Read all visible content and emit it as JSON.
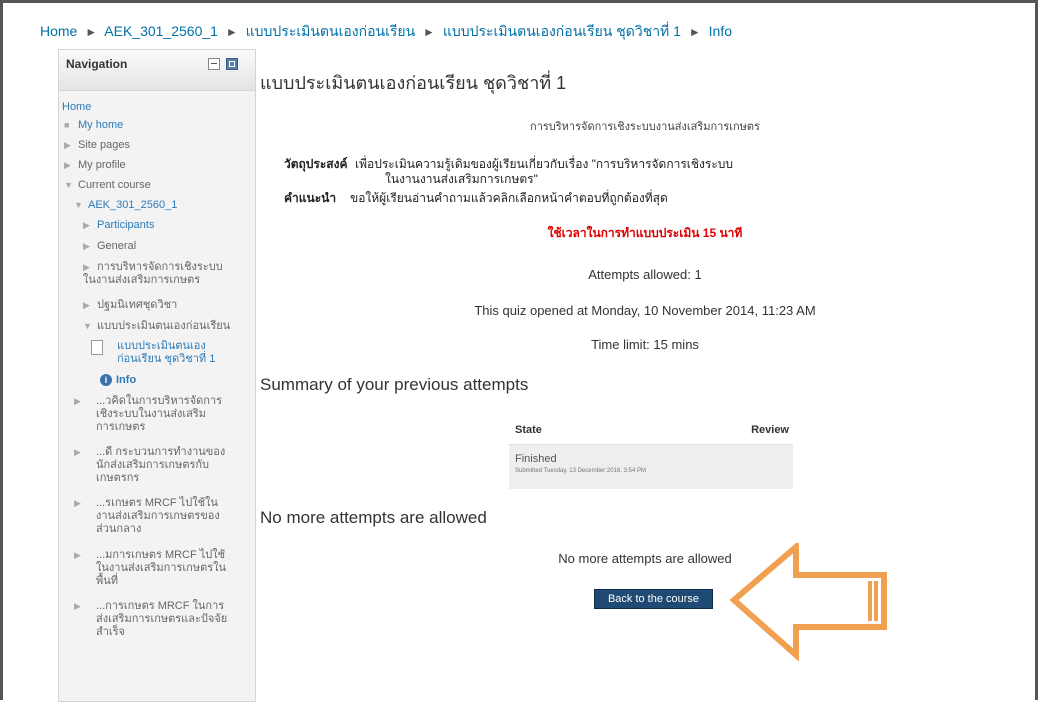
{
  "breadcrumb": {
    "home": "Home",
    "course": "AEK_301_2560_1",
    "section": "แบบประเมินตนเองก่อนเรียน",
    "quiz": "แบบประเมินตนเองก่อนเรียน ชุดวิชาที่ 1",
    "current": "Info",
    "sep": "►"
  },
  "nav": {
    "title": "Navigation",
    "items": [
      {
        "label": "Home"
      },
      {
        "label": "My home"
      },
      {
        "label": "Site pages"
      },
      {
        "label": "My profile"
      },
      {
        "label": "Current course"
      },
      {
        "label": "AEK_301_2560_1"
      },
      {
        "label": "Participants"
      },
      {
        "label": "General"
      },
      {
        "label": "การบริหารจัดการเชิงระบบในงานส่งเสริมการเกษตร"
      },
      {
        "label": "ปฐมนิเทศชุดวิชา"
      },
      {
        "label": "แบบประเมินตนเองก่อนเรียน"
      },
      {
        "label": "แบบประเมินตนเองก่อนเรียน ชุดวิชาที่ 1"
      },
      {
        "label": "Info"
      },
      {
        "label": "...วคิดในการบริหารจัดการเชิงระบบในงานส่งเสริมการเกษตร"
      },
      {
        "label": "...ดี กระบวนการทำงานของนักส่งเสริมการเกษตรกับเกษตรกร"
      },
      {
        "label": "...รเกษตร MRCF ไปใช้ในงานส่งเสริมการเกษตรของส่วนกลาง"
      },
      {
        "label": "...มการเกษตร MRCF ไปใช้ในงานส่งเสริมการเกษตรในพื้นที่"
      },
      {
        "label": "...การเกษตร MRCF ในการส่งเสริมการเกษตรและปัจจัยสำเร็จ"
      }
    ]
  },
  "main": {
    "title": "แบบประเมินตนเองก่อนเรียน ชุดวิชาที่ 1",
    "subject": "การบริหารจัดการเชิงระบบงานส่งเสริมการเกษตร",
    "objective_label": "วัตถุประสงค์",
    "objective_text_1": "เพื่อประเมินความรู้เดิมของผู้เรียนเกี่ยวกับเรื่อง \"การบริหารจัดการเชิงระบบ",
    "objective_text_2": "ในงานงานส่งเสริมการเกษตร\"",
    "instruction_label": "คำแนะนำ",
    "instruction_text": "ขอให้ผู้เรียนอ่านคำถามแล้วคลิกเลือกหน้าคำตอบที่ถูกต้องที่สุด",
    "time_note": "ใช้เวลาในการทำแบบประเมิน 15 นาที",
    "attempts_allowed": "Attempts allowed: 1",
    "opened": "This quiz opened at Monday, 10 November 2014, 11:23 AM",
    "time_limit": "Time limit: 15 mins",
    "summary_heading": "Summary of your previous attempts",
    "table": {
      "col_state": "State",
      "col_review": "Review",
      "row_state": "Finished",
      "row_submitted": "Submitted Tuesday, 13 December 2016, 3:54 PM"
    },
    "no_more_heading": "No more attempts are allowed",
    "no_more_text": "No more attempts are allowed",
    "back_button": "Back to the course"
  },
  "colors": {
    "link": "#0070a8",
    "alert_red": "#e00000",
    "button_bg": "#1e4a73",
    "arrow_orange": "#f0a050"
  },
  "icons": {
    "expand": "triangle-right-icon",
    "collapse": "triangle-down-icon",
    "bullet": "square-bullet-icon",
    "quiz": "quiz-icon",
    "info": "info-icon",
    "annotation": "arrow-left-annotation"
  }
}
